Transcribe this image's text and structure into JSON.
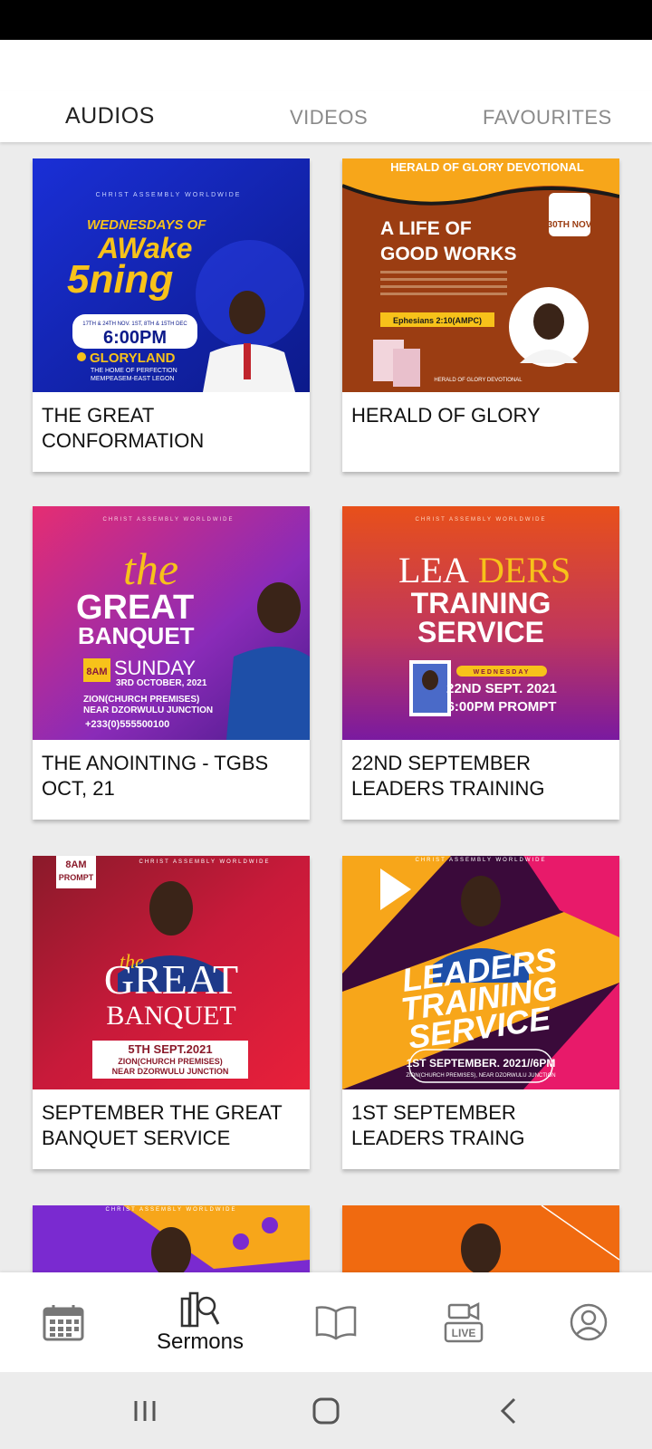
{
  "tabs": [
    {
      "label": "AUDIOS",
      "active": true
    },
    {
      "label": "VIDEOS",
      "active": false
    },
    {
      "label": "FAVOURITES",
      "active": false
    }
  ],
  "sermons": [
    {
      "title": "THE GREAT CONFORMATION",
      "poster": {
        "org": "CHRIST ASSEMBLY WORLDWIDE",
        "line1": "WEDNESDAYS OF",
        "line2": "AWake",
        "line3": "5ning",
        "dates": "17TH & 24TH NOV. 1ST, 8TH & 15TH DEC",
        "time": "6:00PM",
        "venue": "GLORYLAND",
        "venue_sub1": "THE HOME OF PERFECTION",
        "venue_sub2": "MEMPEASEM-EAST LEGON"
      }
    },
    {
      "title": "HERALD OF GLORY",
      "poster": {
        "header": "HERALD OF GLORY DEVOTIONAL",
        "date": "30TH NOV",
        "line1": "A LIFE OF",
        "line2": "GOOD WORKS",
        "ref": "Ephesians 2:10(AMPC)",
        "footer": "HERALD OF GLORY DEVOTIONAL"
      }
    },
    {
      "title": "THE ANOINTING - TGBS OCT, 21",
      "poster": {
        "org": "CHRIST ASSEMBLY WORLDWIDE",
        "script": "the",
        "line1": "GREAT",
        "line2": "BANQUET",
        "time": "8AM",
        "day": "SUNDAY",
        "date": "3RD OCTOBER, 2021",
        "venue1": "ZION(CHURCH PREMISES)",
        "venue2": "NEAR DZORWULU JUNCTION",
        "phone": "+233(0)555500100"
      }
    },
    {
      "title": "22ND SEPTEMBER LEADERS TRAINING",
      "poster": {
        "org": "CHRIST ASSEMBLY WORLDWIDE",
        "line1a": "LEA",
        "line1b": "DERS",
        "line2": "TRAINING",
        "line3": "SERVICE",
        "day": "WEDNESDAY",
        "date": "22ND SEPT. 2021",
        "time": "6:00PM PROMPT"
      }
    },
    {
      "title": "SEPTEMBER THE GREAT BANQUET SERVICE",
      "poster": {
        "badge1": "8AM",
        "badge2": "PROMPT",
        "org": "CHRIST ASSEMBLY WORLDWIDE",
        "script": "the",
        "line1": "GREAT",
        "line2": "BANQUET",
        "date": "5TH SEPT.2021",
        "venue1": "ZION(CHURCH PREMISES)",
        "venue2": "NEAR DZORWULU JUNCTION"
      }
    },
    {
      "title": "1ST SEPTEMBER LEADERS TRAING",
      "poster": {
        "org": "CHRIST ASSEMBLY WORLDWIDE",
        "line1": "LEADERS",
        "line2": "TRAINING",
        "line3": "SERVICE",
        "date": "1ST SEPTEMBER. 2021//6PM",
        "venue": "ZION(CHURCH PREMISES), NEAR DZORWULU JUNCTION"
      }
    },
    {
      "title": "",
      "poster": {
        "org": "CHRIST ASSEMBLY WORLDWIDE"
      }
    },
    {
      "title": "",
      "poster": {}
    }
  ],
  "bottom_nav": [
    {
      "icon": "calendar-icon",
      "label": ""
    },
    {
      "icon": "sermons-icon",
      "label": "Sermons",
      "active": true
    },
    {
      "icon": "book-icon",
      "label": ""
    },
    {
      "icon": "live-video-icon",
      "label": "",
      "badge": "LIVE"
    },
    {
      "icon": "profile-icon",
      "label": ""
    }
  ],
  "system_nav": [
    {
      "icon": "recent-apps-icon"
    },
    {
      "icon": "home-icon"
    },
    {
      "icon": "back-icon"
    }
  ],
  "colors": {
    "background": "#ececec",
    "card": "#ffffff",
    "tab_active": "#222222",
    "tab_inactive": "#8a8a8a"
  }
}
